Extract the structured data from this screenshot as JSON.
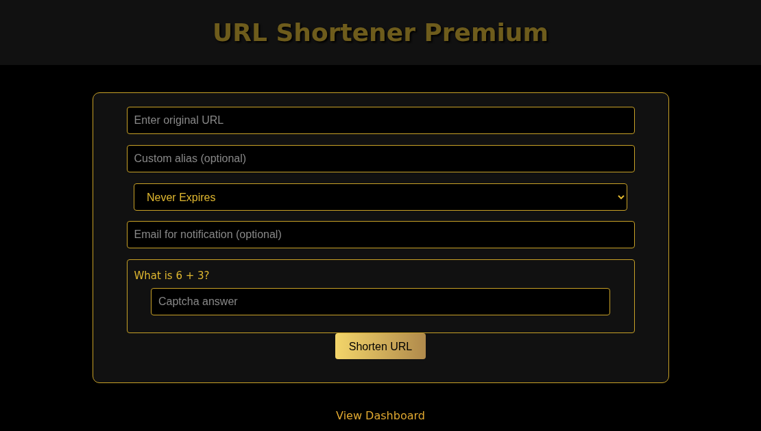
{
  "header": {
    "title": "URL Shortener Premium"
  },
  "form": {
    "fields": [
      {
        "kind": "input",
        "placeholder": "Enter original URL"
      },
      {
        "kind": "input",
        "placeholder": "Custom alias (optional)"
      },
      {
        "kind": "select",
        "value": "Never Expires"
      },
      {
        "kind": "input",
        "placeholder": "Email for notification (optional)"
      }
    ],
    "captcha": {
      "question": "What is 6 + 3?",
      "placeholder": "Captcha answer"
    },
    "submit": "Shorten URL"
  },
  "footer_link": "View Dashboard"
}
